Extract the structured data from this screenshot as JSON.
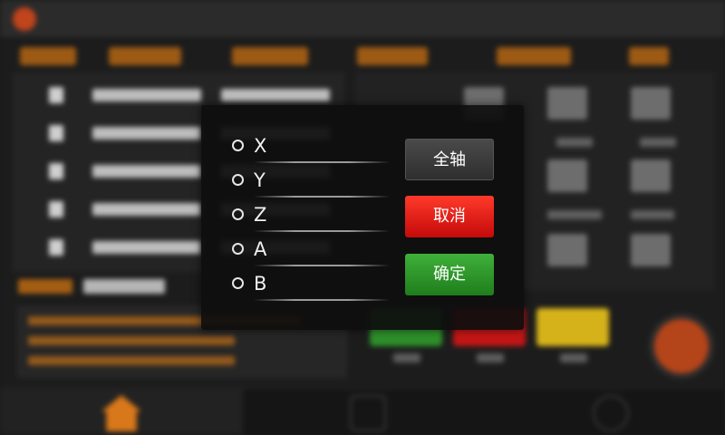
{
  "dialog": {
    "options": [
      {
        "label": "X"
      },
      {
        "label": "Y"
      },
      {
        "label": "Z"
      },
      {
        "label": "A"
      },
      {
        "label": "B"
      }
    ],
    "buttons": {
      "all_axes": "全轴",
      "cancel": "取消",
      "confirm": "确定"
    }
  },
  "colors": {
    "accent_orange": "#c76f12",
    "cancel_red": "#e01a14",
    "confirm_green": "#2e9a2a",
    "dialog_bg": "#0e0e0e"
  },
  "icons": {
    "logo": "logo-icon",
    "home": "home-icon",
    "radio": "radio-circle-icon"
  }
}
